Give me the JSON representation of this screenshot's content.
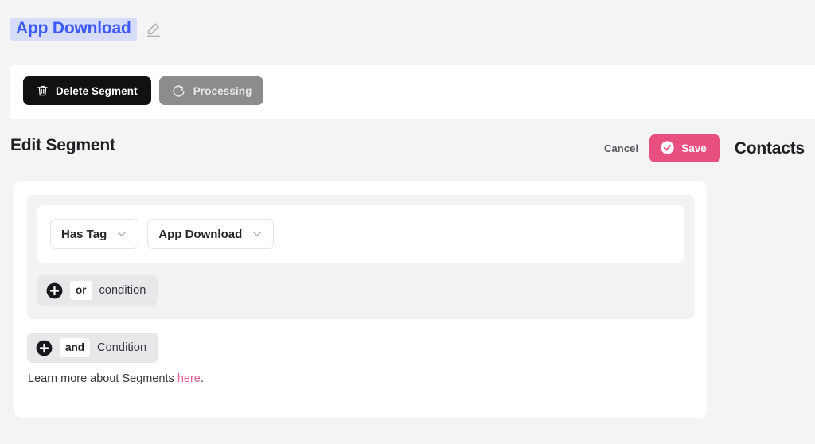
{
  "header": {
    "segment_title": "App Download",
    "edit_icon": "pencil-icon"
  },
  "toolbar": {
    "delete_label": "Delete Segment",
    "delete_icon": "trash-icon",
    "processing_label": "Processing",
    "processing_icon": "refresh-spinner-icon"
  },
  "edit_header": {
    "title": "Edit Segment",
    "cancel_label": "Cancel",
    "save_label": "Save",
    "save_icon": "circle-check-icon",
    "contacts_label": "Contacts"
  },
  "builder": {
    "condition": {
      "operator_value": "Has Tag",
      "value_value": "App Download",
      "chevron_icon": "chevron-down-icon"
    },
    "or_chip": {
      "plus_icon": "plus-circle-icon",
      "keyword": "or",
      "text": "condition"
    },
    "and_chip": {
      "plus_icon": "plus-circle-icon",
      "keyword": "and",
      "text": "Condition"
    },
    "learn_more": {
      "prefix": "Learn more about Segments ",
      "link": "here",
      "suffix": "."
    }
  },
  "colors": {
    "accent_pink": "#e8517f",
    "link_pink": "#f06292",
    "title_blue": "#3d5afe",
    "title_highlight": "#d7dcfb",
    "page_bg": "#f4f4f5",
    "group_bg": "#f2f2f3",
    "chip_bg": "#e8e8ea",
    "dark_button": "#111111",
    "gray_button": "#8c8c8c"
  }
}
